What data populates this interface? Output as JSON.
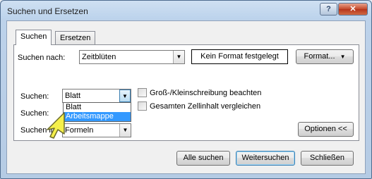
{
  "window": {
    "title": "Suchen und Ersetzen"
  },
  "titlebar": {
    "help_glyph": "?",
    "close_glyph": "✕"
  },
  "tabs": [
    {
      "label": "Suchen",
      "active": true
    },
    {
      "label": "Ersetzen",
      "active": false
    }
  ],
  "find_what": {
    "label": "Suchen nach:",
    "value": "Zeitblüten"
  },
  "format_preview": {
    "text": "Kein Format festgelegt"
  },
  "format_button": {
    "label": "Format..."
  },
  "within": {
    "label": "Suchen:",
    "value": "Blatt"
  },
  "dropdown": {
    "options": [
      "Blatt",
      "Arbeitsmappe"
    ],
    "highlighted": "Arbeitsmappe"
  },
  "search": {
    "label": "Suchen:"
  },
  "look_in": {
    "label": "Suchen in:",
    "value": "Formeln"
  },
  "options": [
    {
      "label": "Groß-/Kleinschreibung beachten",
      "checked": false
    },
    {
      "label": "Gesamten Zellinhalt vergleichen",
      "checked": false
    }
  ],
  "options_button": {
    "label": "Optionen <<"
  },
  "footer": {
    "find_all": "Alle suchen",
    "find_next": "Weitersuchen",
    "close": "Schließen"
  },
  "colors": {
    "selection": "#3399ff",
    "cursor": "#f5f04a"
  },
  "icons": {
    "cursor": "arrow-cursor-icon",
    "dropdown": "chevron-down-icon"
  }
}
